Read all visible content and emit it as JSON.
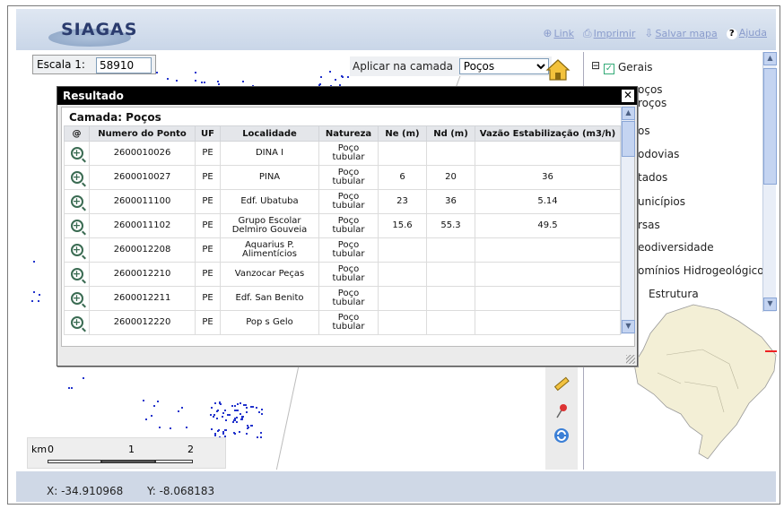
{
  "header": {
    "logo_text": "SIAGAS",
    "links": [
      {
        "label": "Link",
        "icon": "link-icon"
      },
      {
        "label": "Imprimir",
        "icon": "printer-icon"
      },
      {
        "label": "Salvar mapa",
        "icon": "save-map-icon"
      },
      {
        "label": "Ajuda",
        "icon": "help-icon"
      }
    ]
  },
  "scale": {
    "label": "Escala 1:",
    "value": "58910"
  },
  "apply_layer": {
    "label": "Aplicar na camada",
    "selected": "Poços"
  },
  "dialog": {
    "title": "Resultado",
    "layer_title": "Camada: Poços",
    "columns": [
      "@",
      "Numero do Ponto",
      "UF",
      "Localidade",
      "Natureza",
      "Ne (m)",
      "Nd (m)",
      "Vazão Estabilização (m3/h)"
    ],
    "rows": [
      {
        "numero": "2600010026",
        "uf": "PE",
        "localidade": "DINA I",
        "natureza": "Poço tubular",
        "ne": "",
        "nd": "",
        "vazao": ""
      },
      {
        "numero": "2600010027",
        "uf": "PE",
        "localidade": "PINA",
        "natureza": "Poço tubular",
        "ne": "6",
        "nd": "20",
        "vazao": "36"
      },
      {
        "numero": "2600011100",
        "uf": "PE",
        "localidade": "Edf. Ubatuba",
        "natureza": "Poço tubular",
        "ne": "23",
        "nd": "36",
        "vazao": "5.14"
      },
      {
        "numero": "2600011102",
        "uf": "PE",
        "localidade": "Grupo Escolar Delmiro Gouveia",
        "natureza": "Poço tubular",
        "ne": "15.6",
        "nd": "55.3",
        "vazao": "49.5"
      },
      {
        "numero": "2600012208",
        "uf": "PE",
        "localidade": "Aquarius P. Alimentícios",
        "natureza": "Poço tubular",
        "ne": "",
        "nd": "",
        "vazao": ""
      },
      {
        "numero": "2600012210",
        "uf": "PE",
        "localidade": "Vanzocar Peças",
        "natureza": "Poço tubular",
        "ne": "",
        "nd": "",
        "vazao": ""
      },
      {
        "numero": "2600012211",
        "uf": "PE",
        "localidade": "Edf. San Benito",
        "natureza": "Poço tubular",
        "ne": "",
        "nd": "",
        "vazao": ""
      },
      {
        "numero": "2600012220",
        "uf": "PE",
        "localidade": "Pop s Gelo",
        "natureza": "Poço tubular",
        "ne": "",
        "nd": "",
        "vazao": ""
      }
    ]
  },
  "layers": {
    "items": [
      {
        "label": "Gerais",
        "checked": true
      },
      {
        "label": "oços"
      },
      {
        "label": "roços"
      },
      {
        "label": "os"
      },
      {
        "label": "odovias"
      },
      {
        "label": "tados"
      },
      {
        "label": "unicípios"
      },
      {
        "label": "rsas"
      },
      {
        "label": "eodiversidade"
      },
      {
        "label": "omínios Hidrogeológicos"
      },
      {
        "label": "Estrutura"
      }
    ]
  },
  "scalebar": {
    "unit": "km",
    "labels": [
      "0",
      "1",
      "2"
    ]
  },
  "coords": {
    "x": "X: -34.910968",
    "y": "Y: -8.068183"
  },
  "colors": {
    "points": "#2233cc",
    "header": "#cdd8e8",
    "marker": "#ee2222"
  }
}
